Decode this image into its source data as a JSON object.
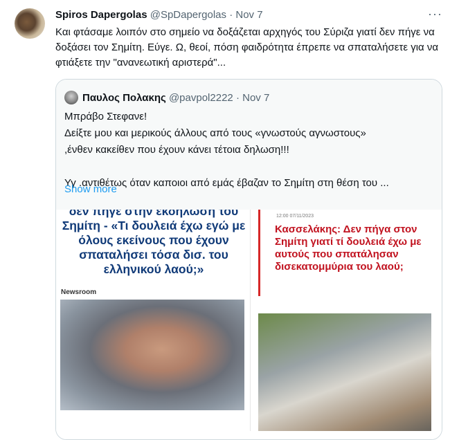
{
  "tweet": {
    "name": "Spiros Dapergolas",
    "handle": "@SpDapergolas",
    "separator": "·",
    "date": "Nov 7",
    "more": "···",
    "text": "Και φτάσαμε λοιπόν στο σημείο να δοξάζεται αρχηγός του Σύριζα γιατί δεν πήγε να δοξάσει τον Σημίτη. Εύγε. Ω, θεοί, πόση φαιδρότητα έπρεπε να σπαταλήσετε για να φτιάξετε την \"ανανεωτική αριστερά\"..."
  },
  "quote": {
    "name": "Παυλος Πολακης",
    "handle": "@pavpol2222",
    "separator": "·",
    "date": "Nov 7",
    "lines": [
      "Μπράβο Στεφανε!",
      "Δείξτε μου και μερικούς άλλους από τους «γνωστούς αγνωστους»",
      ",ένθεν κακείθεν που έχουν κάνει τέτοια δηλωση!!!",
      "",
      "Υγ .αντιθέτως όταν καποιοι από εμάς έβαζαν το Σημίτη στη θέση του ..."
    ],
    "show_more": "Show more"
  },
  "media": {
    "card1": {
      "headline": "δεν πήγε στην εκδήλωση του Σημίτη - «Τι δουλειά έχω εγώ με όλους εκείνους που έχουν σπαταλήσει τόσα δισ. του ελληνικού λαού;»",
      "source": "Newsroom"
    },
    "card2": {
      "meta": "12:00 07/11/2023",
      "headline": "Κασσελάκης: Δεν πήγα στον Σημίτη γιατί τί δουλειά έχω με αυτούς που σπατάλησαν δισεκατομμύρια του λαού;"
    }
  }
}
